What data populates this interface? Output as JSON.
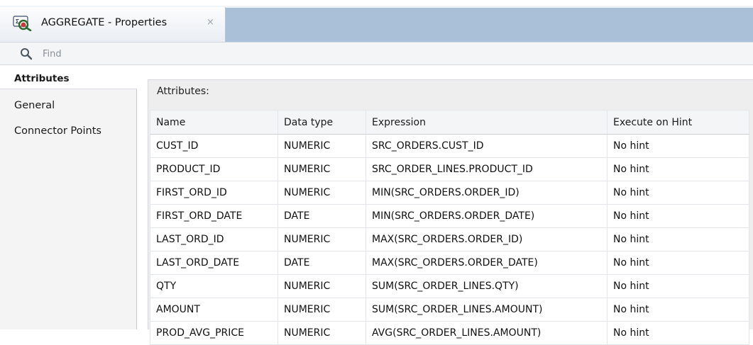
{
  "tab": {
    "icon": "aggregate-component-icon",
    "title": "AGGREGATE - Properties",
    "close_glyph": "×"
  },
  "find": {
    "icon": "search-icon",
    "placeholder": "Find"
  },
  "sidebar": {
    "items": [
      {
        "label": "Attributes",
        "active": true
      },
      {
        "label": "General",
        "active": false
      },
      {
        "label": "Connector Points",
        "active": false
      }
    ]
  },
  "main": {
    "section_label": "Attributes:",
    "columns": [
      "Name",
      "Data type",
      "Expression",
      "Execute on Hint"
    ],
    "rows": [
      [
        "CUST_ID",
        "NUMERIC",
        "SRC_ORDERS.CUST_ID",
        "No hint"
      ],
      [
        "PRODUCT_ID",
        "NUMERIC",
        "SRC_ORDER_LINES.PRODUCT_ID",
        "No hint"
      ],
      [
        "FIRST_ORD_ID",
        "NUMERIC",
        "MIN(SRC_ORDERS.ORDER_ID)",
        "No hint"
      ],
      [
        "FIRST_ORD_DATE",
        "DATE",
        "MIN(SRC_ORDERS.ORDER_DATE)",
        "No hint"
      ],
      [
        "LAST_ORD_ID",
        "NUMERIC",
        "MAX(SRC_ORDERS.ORDER_ID)",
        "No hint"
      ],
      [
        "LAST_ORD_DATE",
        "DATE",
        "MAX(SRC_ORDERS.ORDER_DATE)",
        "No hint"
      ],
      [
        "QTY",
        "NUMERIC",
        "SUM(SRC_ORDER_LINES.QTY)",
        "No hint"
      ],
      [
        "AMOUNT",
        "NUMERIC",
        "SUM(SRC_ORDER_LINES.AMOUNT)",
        "No hint"
      ],
      [
        "PROD_AVG_PRICE",
        "NUMERIC",
        "AVG(SRC_ORDER_LINES.AMOUNT)",
        "No hint"
      ]
    ]
  },
  "colors": {
    "tab_strip_dark": "#aac0d8",
    "active_nav_bg": "#ffffff",
    "panel_bg": "#eeeeee"
  }
}
